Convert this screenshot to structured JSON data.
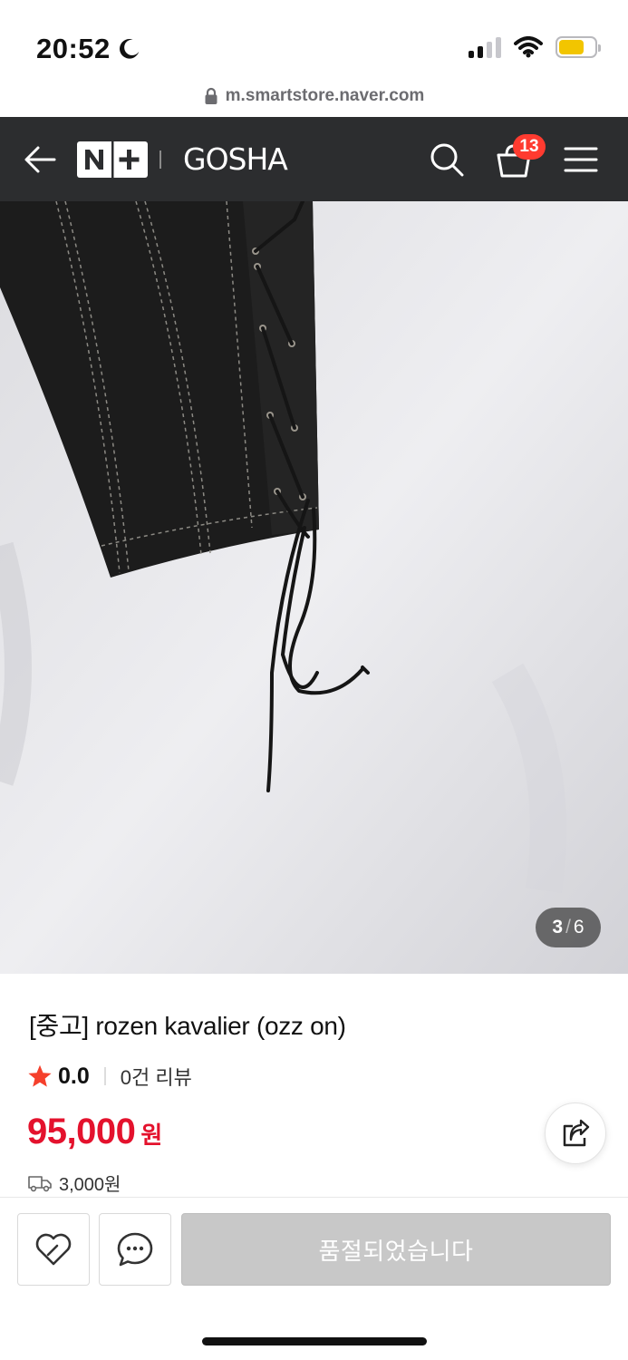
{
  "status_bar": {
    "time": "20:52"
  },
  "browser": {
    "url": "m.smartstore.naver.com"
  },
  "header": {
    "brand_badge": "N+",
    "store_name": "GOSHA",
    "cart_count": "13"
  },
  "gallery": {
    "current": "3",
    "separator": "/",
    "total": "6"
  },
  "product": {
    "title": "[중고] rozen kavalier (ozz on)",
    "rating": "0.0",
    "review_count": "0건 리뷰",
    "price": "95,000",
    "currency": "원",
    "shipping_fee": "3,000원"
  },
  "actions": {
    "soldout_label": "품절되었습니다"
  },
  "colors": {
    "header_bg": "#2c2d2f",
    "price": "#e4122d",
    "star": "#f5402c",
    "badge": "#ff3b30",
    "soldout_bg": "#c8c8c8"
  }
}
